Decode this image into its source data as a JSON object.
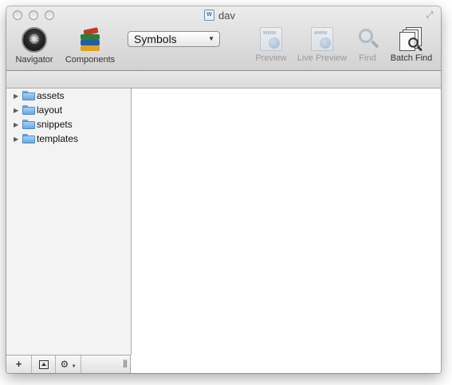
{
  "window": {
    "title": "dav",
    "fullscreen_glyph": "⤢"
  },
  "toolbar": {
    "navigator_label": "Navigator",
    "components_label": "Components",
    "mode_select": {
      "value": "Symbols",
      "arrow": "▼"
    },
    "preview_label": "Preview",
    "live_preview_label": "Live Preview",
    "find_label": "Find",
    "batch_find_label": "Batch Find",
    "icon_www_text": "www"
  },
  "sidebar": {
    "items": [
      {
        "label": "assets",
        "icon": "folder-icon",
        "disclosure": "▶"
      },
      {
        "label": "layout",
        "icon": "folder-icon",
        "disclosure": "▶"
      },
      {
        "label": "snippets",
        "icon": "folder-icon",
        "disclosure": "▶"
      },
      {
        "label": "templates",
        "icon": "folder-icon",
        "disclosure": "▶"
      }
    ]
  },
  "bottombar": {
    "add": "+",
    "gear": "⚙",
    "gear_caret": "▼",
    "resize": "|||"
  },
  "colors": {
    "folder_blue": "#6aa8e2",
    "toolbar_gradient_top": "#ececec",
    "toolbar_gradient_bottom": "#d2d2d2"
  }
}
